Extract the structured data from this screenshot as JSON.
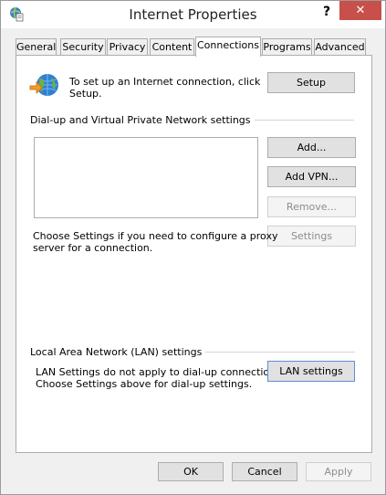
{
  "window": {
    "title": "Internet Properties",
    "help_label": "?",
    "close_label": "✕"
  },
  "tabs": [
    {
      "label": "General"
    },
    {
      "label": "Security"
    },
    {
      "label": "Privacy"
    },
    {
      "label": "Content"
    },
    {
      "label": "Connections",
      "active": true
    },
    {
      "label": "Programs"
    },
    {
      "label": "Advanced"
    }
  ],
  "setup": {
    "text_line1": "To set up an Internet connection, click",
    "text_line2": "Setup.",
    "button_label": "Setup"
  },
  "dialup": {
    "group_label": "Dial-up and Virtual Private Network settings",
    "add_label": "Add...",
    "add_vpn_label": "Add VPN...",
    "remove_label": "Remove...",
    "settings_label": "Settings",
    "hint_line1": "Choose Settings if you need to configure a proxy",
    "hint_line2": "server for a connection."
  },
  "lan": {
    "group_label": "Local Area Network (LAN) settings",
    "text_line1": "LAN Settings do not apply to dial-up connections.",
    "text_line2": "Choose Settings above for dial-up settings.",
    "button_label": "LAN settings"
  },
  "footer": {
    "ok_label": "OK",
    "cancel_label": "Cancel",
    "apply_label": "Apply"
  },
  "colors": {
    "close_button": "#c7504a",
    "panel_background": "#ffffff",
    "dialog_background": "#f0f0f0"
  },
  "icons": {
    "app": "internet-options-icon",
    "setup": "globe-arrow-icon"
  }
}
